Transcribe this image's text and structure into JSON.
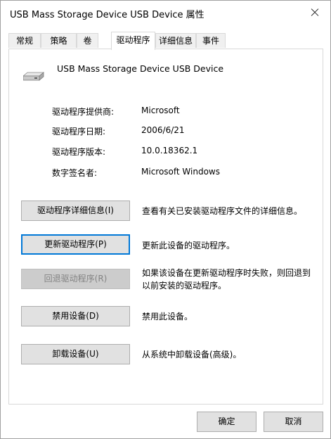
{
  "window": {
    "title": "USB Mass Storage Device USB Device 属性"
  },
  "tabs": [
    {
      "label": "常规"
    },
    {
      "label": "策略"
    },
    {
      "label": "卷"
    },
    {
      "label": "驱动程序"
    },
    {
      "label": "详细信息"
    },
    {
      "label": "事件"
    }
  ],
  "active_tab": "驱动程序",
  "device": {
    "name": "USB Mass Storage Device USB Device",
    "icon": "usb-drive-icon"
  },
  "info": [
    {
      "label": "驱动程序提供商:",
      "value": "Microsoft"
    },
    {
      "label": "驱动程序日期:",
      "value": "2006/6/21"
    },
    {
      "label": "驱动程序版本:",
      "value": "10.0.18362.1"
    },
    {
      "label": "数字签名者:",
      "value": "Microsoft Windows"
    }
  ],
  "actions": [
    {
      "button": "驱动程序详细信息(I)",
      "desc": "查看有关已安装驱动程序文件的详细信息。"
    },
    {
      "button": "更新驱动程序(P)",
      "desc": "更新此设备的驱动程序。"
    },
    {
      "button": "回退驱动程序(R)",
      "desc_line1": "如果该设备在更新驱动程序时失败，则回退到",
      "desc_line2": "以前安装的驱动程序。"
    },
    {
      "button": "禁用设备(D)",
      "desc": "禁用此设备。"
    },
    {
      "button": "卸载设备(U)",
      "desc": "从系统中卸载设备(高级)。"
    }
  ],
  "footer": {
    "ok": "确定",
    "cancel": "取消"
  },
  "colors": {
    "focus_border": "#0078d7",
    "button_bg": "#e1e1e1",
    "disabled_bg": "#cccccc"
  }
}
